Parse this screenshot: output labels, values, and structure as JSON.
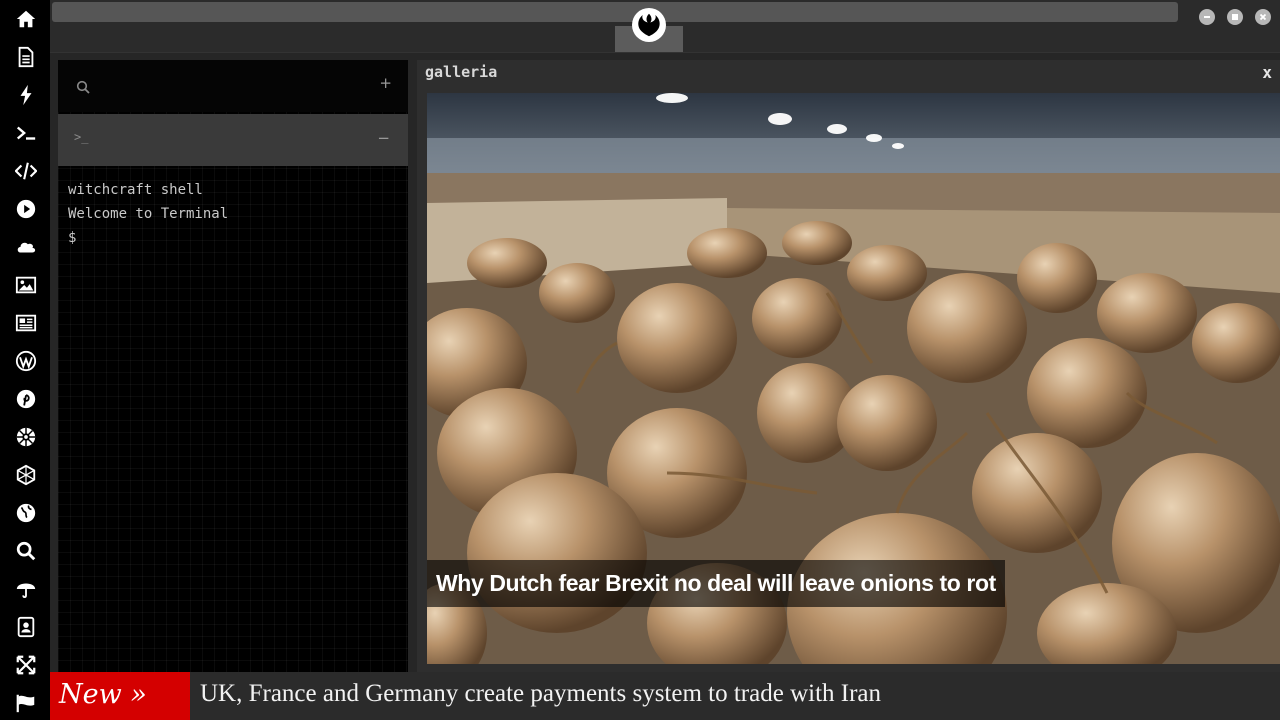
{
  "sidebar": {
    "icons": [
      {
        "name": "home-icon"
      },
      {
        "name": "document-icon"
      },
      {
        "name": "lightning-icon"
      },
      {
        "name": "terminal-icon"
      },
      {
        "name": "code-icon"
      },
      {
        "name": "play-icon"
      },
      {
        "name": "cloud-icon"
      },
      {
        "name": "image-icon"
      },
      {
        "name": "newspaper-icon"
      },
      {
        "name": "wordpress-icon"
      },
      {
        "name": "pinterest-icon"
      },
      {
        "name": "galactic-empire-icon"
      },
      {
        "name": "hexagon-network-icon"
      },
      {
        "name": "globe-icon"
      },
      {
        "name": "search-icon"
      },
      {
        "name": "umbrella-icon"
      },
      {
        "name": "address-book-icon"
      },
      {
        "name": "expand-arrows-icon"
      },
      {
        "name": "flag-icon"
      }
    ]
  },
  "topbar": {
    "emblem": "rebel-alliance-icon",
    "window_controls": [
      "minimize-icon",
      "maximize-icon",
      "close-icon"
    ]
  },
  "terminal": {
    "add_label": "+",
    "tab_prompt": ">_",
    "collapse_label": "−",
    "lines": [
      "witchcraft shell",
      "Welcome to Terminal",
      "$"
    ]
  },
  "gallery": {
    "title": "galleria",
    "close_label": "x",
    "caption": "Why Dutch fear Brexit no deal will leave onions to rot"
  },
  "ticker": {
    "badge": "New »",
    "headline": "UK, France and Germany create payments system to trade with Iran"
  },
  "colors": {
    "rail_bg": "#000000",
    "chrome_bg": "#2b2b2b",
    "ticker_badge": "#d40000",
    "icon_white": "#ffffff"
  }
}
